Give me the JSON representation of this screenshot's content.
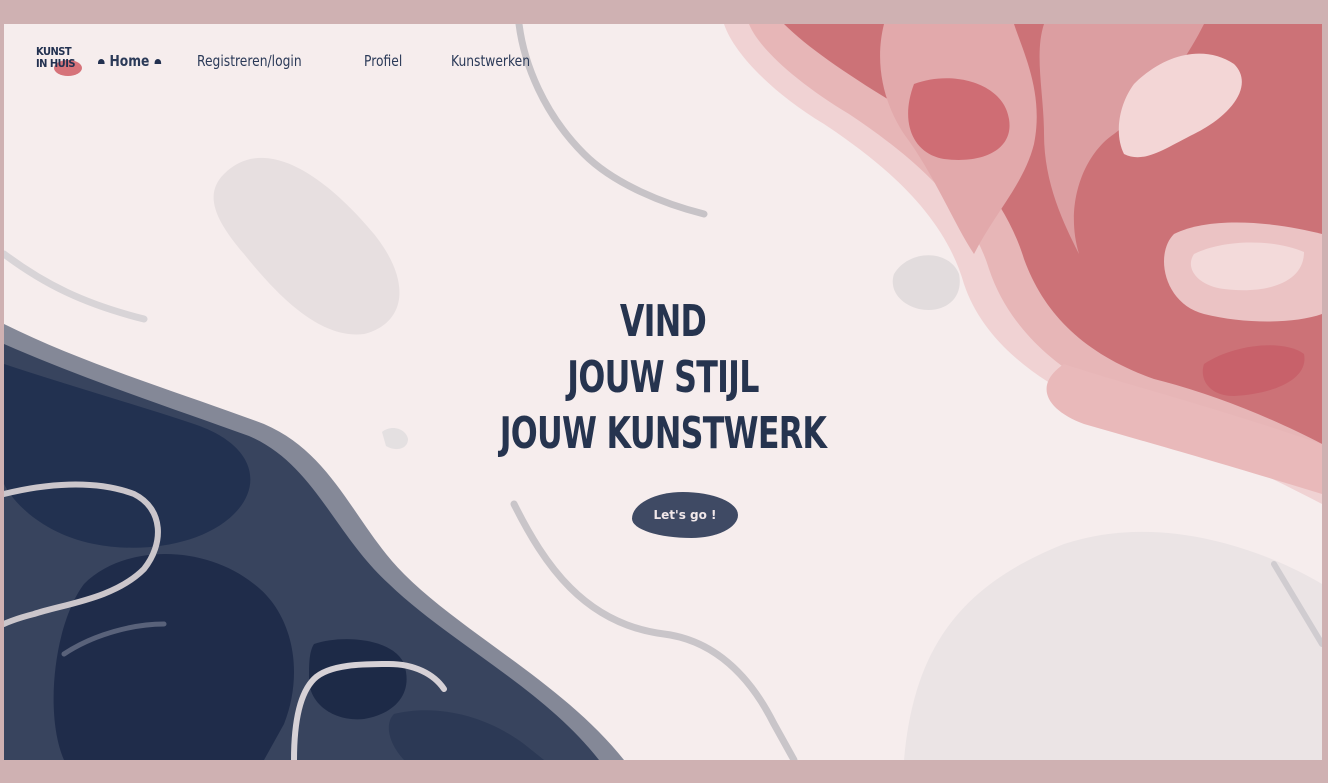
{
  "logo": {
    "line1": "KUNST",
    "line2": "IN HUIS"
  },
  "nav": {
    "home": "Home",
    "register": "Registreren/login",
    "profile": "Profiel",
    "artworks": "Kunstwerken"
  },
  "hero": {
    "line1": "VIND",
    "line2": "JOUW STIJL",
    "line3": "JOUW KUNSTWERK",
    "cta": "Let's go !"
  },
  "colors": {
    "page_bg": "#cfb1b2",
    "canvas": "#f6eded",
    "navy": "#26344f",
    "coral": "#c8686e",
    "rose": "#e4b7b7",
    "grey": "#dcd9da"
  }
}
